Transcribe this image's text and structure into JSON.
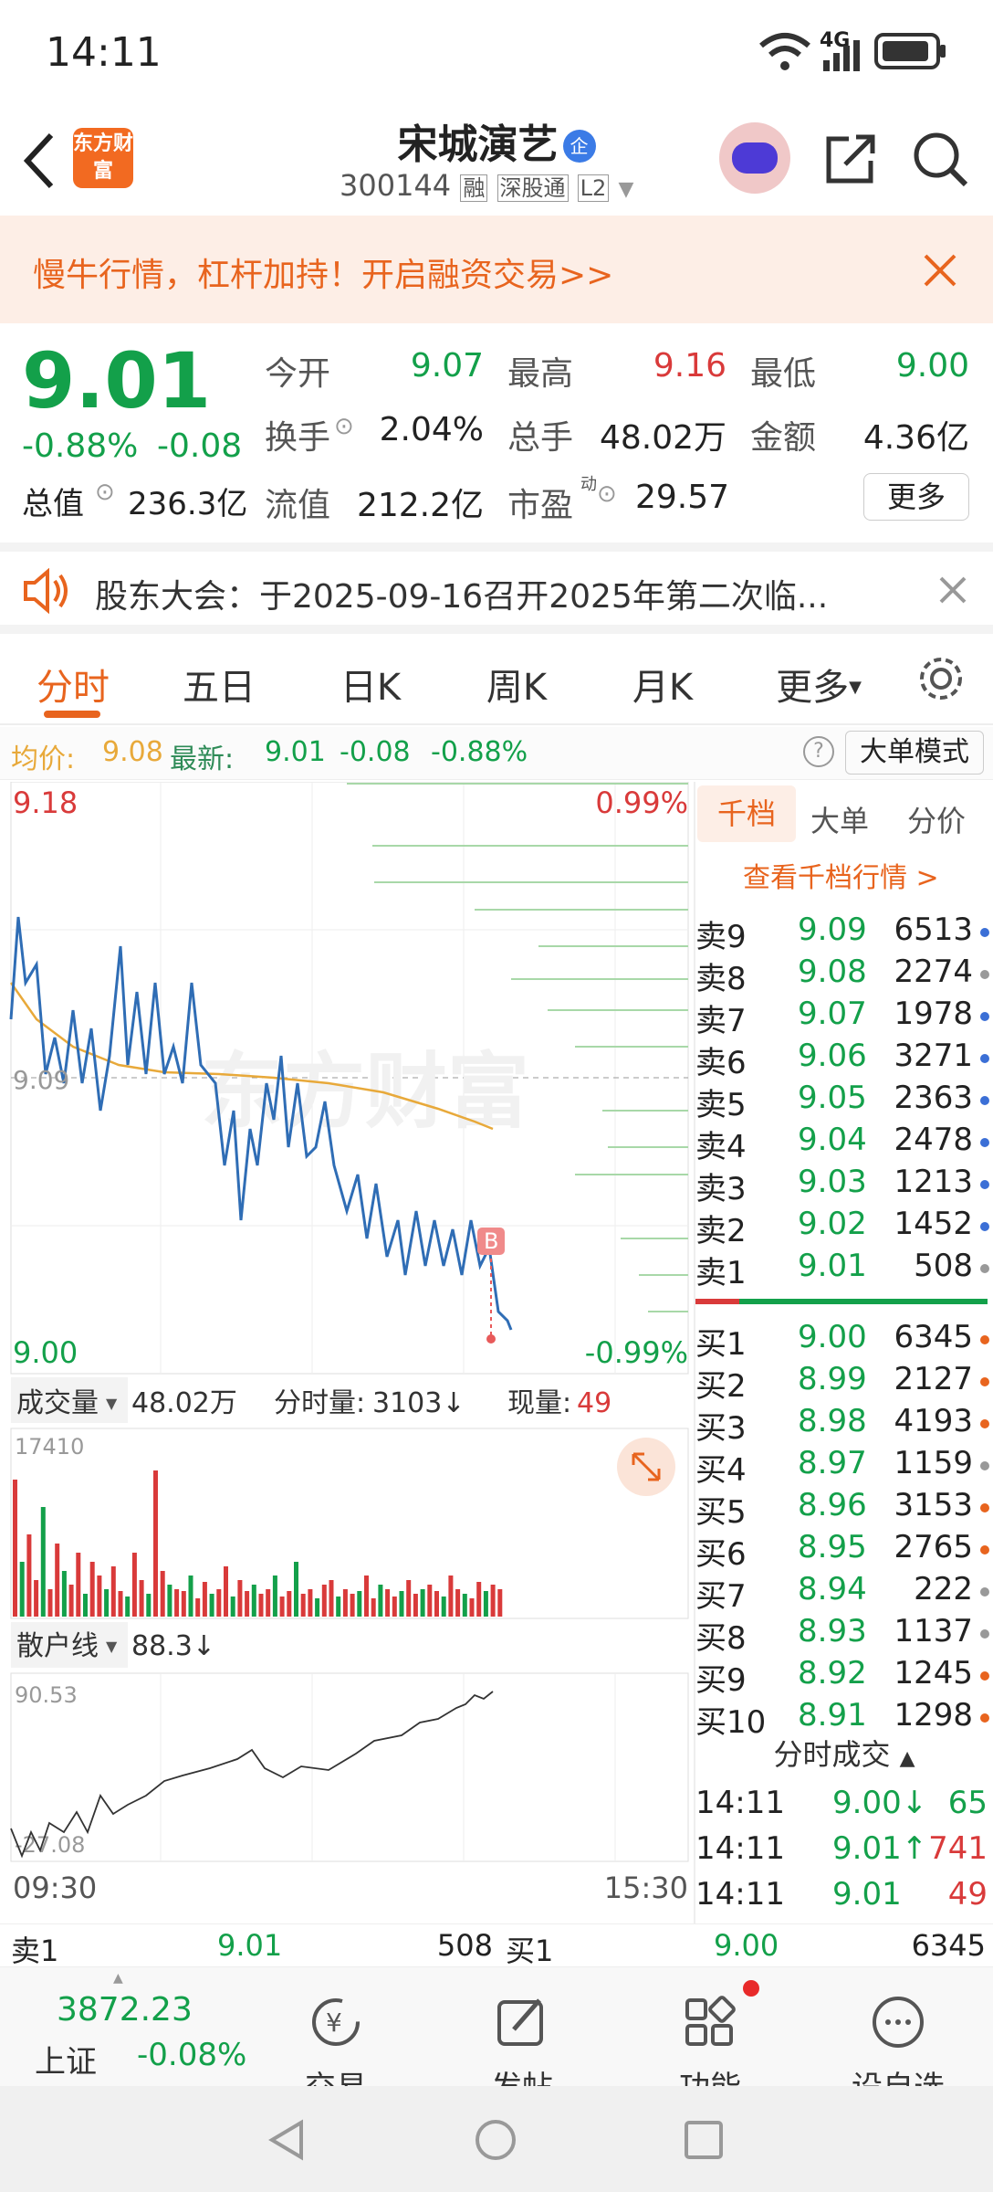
{
  "status_bar": {
    "time": "14:11",
    "network": "4G"
  },
  "header": {
    "logo_text": "东方财富",
    "stock_name": "宋城演艺",
    "badge": "企",
    "code": "300144",
    "tags": [
      "融",
      "深股通",
      "L2"
    ]
  },
  "promo": {
    "text": "慢牛行情，杠杆加持！开启融资交易>>"
  },
  "quote": {
    "price": "9.01",
    "change_pct": "-0.88%",
    "change": "-0.08",
    "total_value_label": "总值",
    "total_value": "236.3亿",
    "fields": {
      "open_label": "今开",
      "open": "9.07",
      "high_label": "最高",
      "high": "9.16",
      "low_label": "最低",
      "low": "9.00",
      "turnover_label": "换手",
      "turnover": "2.04%",
      "volume_label": "总手",
      "volume": "48.02万",
      "amount_label": "金额",
      "amount": "4.36亿",
      "float_label": "流值",
      "float_value": "212.2亿",
      "pe_label": "市盈",
      "pe_sup": "动",
      "pe": "29.57"
    },
    "more_label": "更多"
  },
  "announcement": {
    "text": "股东大会：于2025-09-16召开2025年第二次临..."
  },
  "tabs": [
    "分时",
    "五日",
    "日K",
    "周K",
    "月K",
    "更多"
  ],
  "info_line": {
    "avg_label": "均价:",
    "avg": "9.08",
    "last_label": "最新:",
    "last": "9.01",
    "chg": "-0.08",
    "chg_pct": "-0.88%",
    "mode_label": "大单模式"
  },
  "chart_labels": {
    "top_price": "9.18",
    "top_pct": "0.99%",
    "bottom_price": "9.00",
    "bottom_pct": "-0.99%",
    "mid_price": "9.09",
    "marker": "B",
    "watermark": "东方财富"
  },
  "volume_bar": {
    "dropdown": "成交量",
    "total": "48.02万",
    "period_label": "分时量:",
    "period": "3103↓",
    "now_label": "现量:",
    "now": "49",
    "max": "17410"
  },
  "retail_line": {
    "dropdown": "散户线",
    "value": "88.3↓",
    "max": "90.53",
    "min": "-27.08"
  },
  "time_axis": {
    "start": "09:30",
    "end": "15:30"
  },
  "order_book": {
    "tabs": [
      "千档",
      "大单",
      "分价"
    ],
    "link": "查看千档行情 >",
    "asks": [
      {
        "label": "卖9",
        "price": "9.09",
        "vol": "6513",
        "dot": "#3b6fd6"
      },
      {
        "label": "卖8",
        "price": "9.08",
        "vol": "2274",
        "dot": "#999999"
      },
      {
        "label": "卖7",
        "price": "9.07",
        "vol": "1978",
        "dot": "#3b6fd6"
      },
      {
        "label": "卖6",
        "price": "9.06",
        "vol": "3271",
        "dot": "#3b6fd6"
      },
      {
        "label": "卖5",
        "price": "9.05",
        "vol": "2363",
        "dot": "#3b6fd6"
      },
      {
        "label": "卖4",
        "price": "9.04",
        "vol": "2478",
        "dot": "#3b6fd6"
      },
      {
        "label": "卖3",
        "price": "9.03",
        "vol": "1213",
        "dot": "#3b6fd6"
      },
      {
        "label": "卖2",
        "price": "9.02",
        "vol": "1452",
        "dot": "#3b6fd6"
      },
      {
        "label": "卖1",
        "price": "9.01",
        "vol": "508",
        "dot": "#999999"
      }
    ],
    "bids": [
      {
        "label": "买1",
        "price": "9.00",
        "vol": "6345",
        "dot": "#e8641e"
      },
      {
        "label": "买2",
        "price": "8.99",
        "vol": "2127",
        "dot": "#e8641e"
      },
      {
        "label": "买3",
        "price": "8.98",
        "vol": "4193",
        "dot": "#e8641e"
      },
      {
        "label": "买4",
        "price": "8.97",
        "vol": "1159",
        "dot": "#999999"
      },
      {
        "label": "买5",
        "price": "8.96",
        "vol": "3153",
        "dot": "#e8641e"
      },
      {
        "label": "买6",
        "price": "8.95",
        "vol": "2765",
        "dot": "#e8641e"
      },
      {
        "label": "买7",
        "price": "8.94",
        "vol": "222",
        "dot": "#999999"
      },
      {
        "label": "买8",
        "price": "8.93",
        "vol": "1137",
        "dot": "#999999"
      },
      {
        "label": "买9",
        "price": "8.92",
        "vol": "1245",
        "dot": "#e8641e"
      },
      {
        "label": "买10",
        "price": "8.91",
        "vol": "1298",
        "dot": "#e8641e"
      }
    ],
    "trades_title": "分时成交",
    "trades": [
      {
        "time": "14:11",
        "price": "9.00↓",
        "vol": "65",
        "color": "#13a04a",
        "vcolor": "#13a04a"
      },
      {
        "time": "14:11",
        "price": "9.01↑",
        "vol": "741",
        "color": "#13a04a",
        "vcolor": "#d93a3a"
      },
      {
        "time": "14:11",
        "price": "9.01",
        "vol": "49",
        "color": "#13a04a",
        "vcolor": "#d93a3a"
      }
    ]
  },
  "bottom_quote": {
    "sell_label": "卖1",
    "sell_price": "9.01",
    "sell_vol": "508",
    "buy_label": "买1",
    "buy_price": "9.00",
    "buy_vol": "6345"
  },
  "index": {
    "value": "3872.23",
    "name": "上证",
    "pct": "-0.08%"
  },
  "bottom_nav": [
    "交易",
    "发帖",
    "功能",
    "设自选"
  ],
  "colors": {
    "red": "#d93a3a",
    "green": "#13a04a",
    "accent": "#e8641e",
    "price_line": "#2f6db5",
    "avg_line": "#e8a93a"
  }
}
